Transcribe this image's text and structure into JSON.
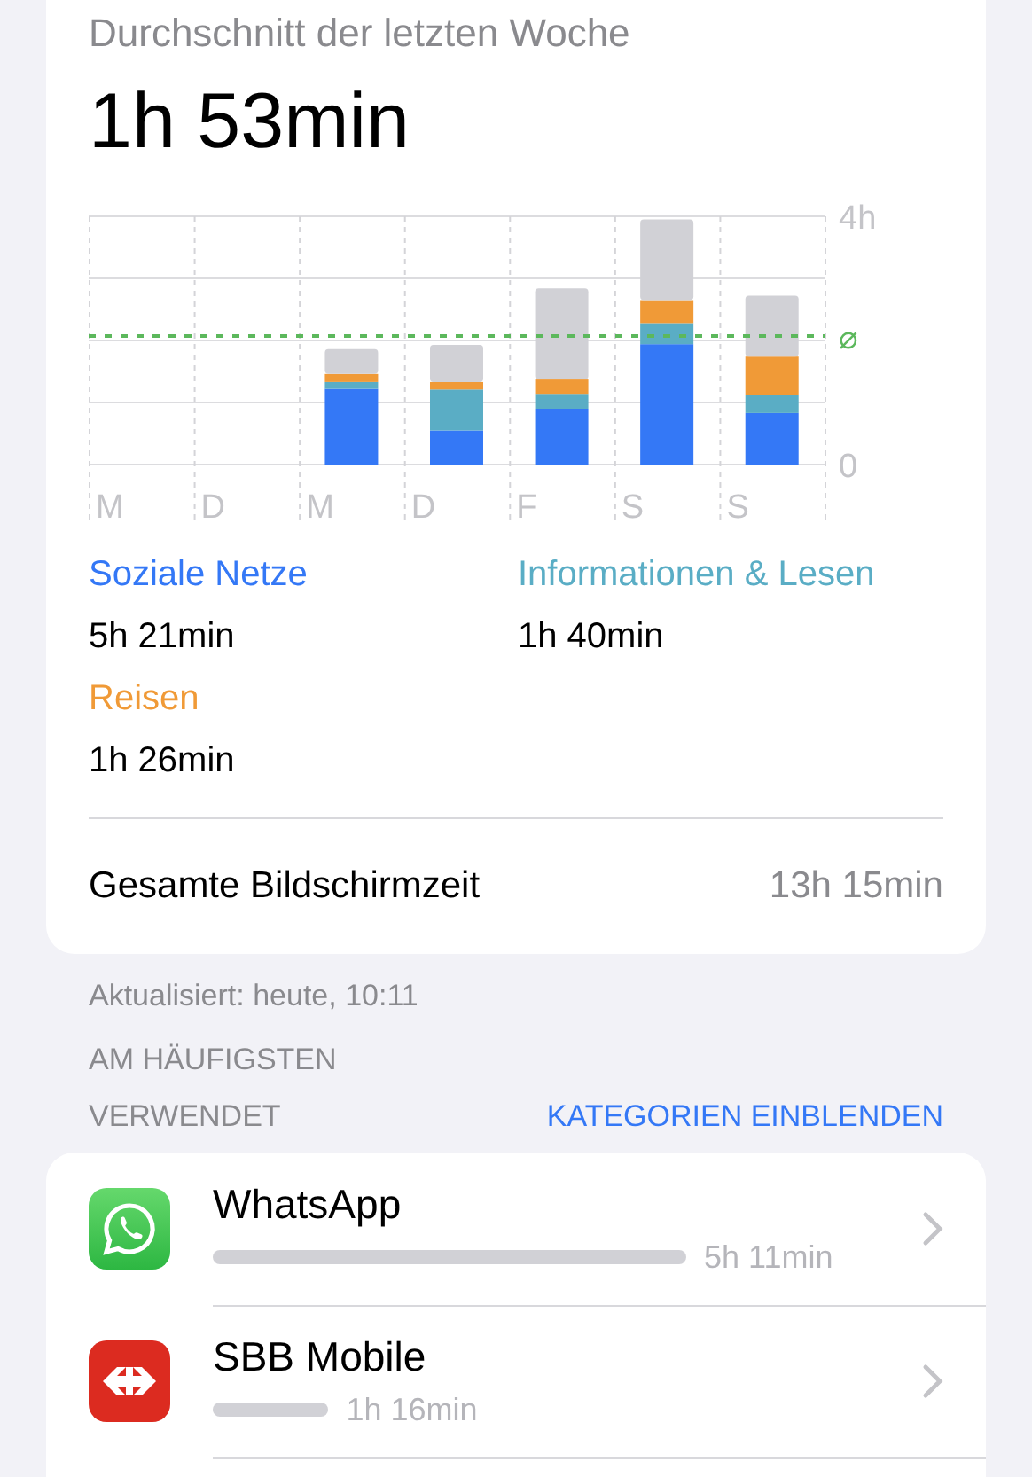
{
  "summary": {
    "title": "Durchschnitt der letzten Woche",
    "average": "1h 53min",
    "chart_data": {
      "type": "bar",
      "stacked": true,
      "categories": [
        "M",
        "D",
        "M",
        "D",
        "F",
        "S",
        "S"
      ],
      "series": [
        {
          "color": "#3478f6",
          "values": [
            null,
            null,
            1.22,
            0.55,
            0.9,
            1.94,
            0.83
          ]
        },
        {
          "color": "#5aadc5",
          "values": [
            null,
            null,
            0.11,
            0.66,
            0.24,
            0.34,
            0.29
          ]
        },
        {
          "color": "#f09a37",
          "values": [
            null,
            null,
            0.13,
            0.12,
            0.23,
            0.37,
            0.62
          ]
        },
        {
          "color": "#d1d1d6",
          "values": [
            null,
            null,
            0.4,
            0.6,
            1.47,
            1.3,
            0.98
          ]
        }
      ],
      "ylim": [
        0,
        4
      ],
      "yticks": [
        {
          "value": 4,
          "label": "4h"
        },
        {
          "value": 0,
          "label": "0"
        }
      ],
      "ref_lines": [
        {
          "axis": "y",
          "value": 2.07,
          "label": "⌀",
          "color": "#5cb85c"
        }
      ]
    },
    "categories": [
      {
        "name": "Soziale Netze",
        "time": "5h 21min",
        "color": "#3478f6"
      },
      {
        "name": "Informationen & Lesen",
        "time": "1h 40min",
        "color": "#5aadc5"
      },
      {
        "name": "Reisen",
        "time": "1h 26min",
        "color": "#f09a37"
      }
    ],
    "total": {
      "label": "Gesamte Bildschirmzeit",
      "value": "13h 15min"
    }
  },
  "updated": "Aktualisiert: heute, 10:11",
  "most_used": {
    "heading_lines": [
      "AM HÄUFIGSTEN",
      "VERWENDET"
    ],
    "action": "KATEGORIEN EINBLENDEN",
    "apps": [
      {
        "kind": "messenger",
        "name": "WhatsApp",
        "time": "5h 11min"
      },
      {
        "kind": "railway",
        "name": "SBB Mobile",
        "time": "1h 16min"
      }
    ]
  }
}
